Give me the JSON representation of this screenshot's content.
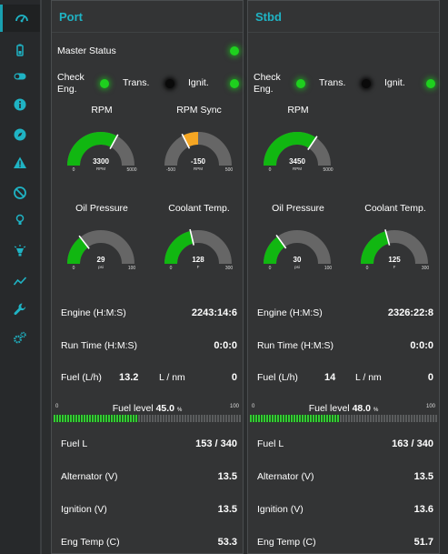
{
  "sidebar": {
    "items": [
      {
        "icon": "gauge-icon",
        "active": true
      },
      {
        "icon": "battery-icon",
        "active": false
      },
      {
        "icon": "toggle-icon",
        "active": false
      },
      {
        "icon": "info-icon",
        "active": false
      },
      {
        "icon": "compass-icon",
        "active": false
      },
      {
        "icon": "warning-icon",
        "active": false
      },
      {
        "icon": "prohibited-icon",
        "active": false
      },
      {
        "icon": "lightbulb-icon",
        "active": false
      },
      {
        "icon": "spotlight-icon",
        "active": false
      },
      {
        "icon": "chart-line-icon",
        "active": false
      },
      {
        "icon": "wrench-icon",
        "active": false
      },
      {
        "icon": "gears-icon",
        "active": false
      }
    ],
    "icon_color": "#1fb3c4"
  },
  "colors": {
    "accent": "#1fb3c4",
    "led_on": "#1ed01e",
    "gauge_green": "#11b711",
    "gauge_orange": "#f5a623",
    "gauge_gray": "#666666"
  },
  "port": {
    "title": "Port",
    "master_status_label": "Master Status",
    "master_status": true,
    "check_eng_label": "Check\nEng.",
    "check_eng": true,
    "trans_label": "Trans.",
    "trans": false,
    "ignit_label": "Ignit.",
    "ignit": true,
    "rpm": {
      "title": "RPM",
      "value": 3300,
      "value_text": "3300",
      "unit": "RPM",
      "min": "0",
      "max": "5000",
      "min_v": 0,
      "max_v": 5000
    },
    "rpm_sync": {
      "title": "RPM Sync",
      "value": -150,
      "value_text": "-150",
      "unit": "RPM",
      "min": "-500",
      "max": "500",
      "min_v": -500,
      "max_v": 500
    },
    "oil": {
      "title": "Oil Pressure",
      "value": 29,
      "value_text": "29",
      "unit": "psi",
      "min": "0",
      "max": "100",
      "min_v": 0,
      "max_v": 100
    },
    "coolant": {
      "title": "Coolant Temp.",
      "value": 128,
      "value_text": "128",
      "unit": "F",
      "min": "0",
      "max": "300",
      "min_v": 0,
      "max_v": 300
    },
    "engine_label": "Engine (H:M:S)",
    "engine_value": "2243:14:6",
    "runtime_label": "Run Time (H:M:S)",
    "runtime_value": "0:0:0",
    "fuel_rate_label": "Fuel (L/h)",
    "fuel_rate_value": "13.2",
    "lnm_label": "L / nm",
    "lnm_value": "0",
    "fuel_level": {
      "label": "Fuel level",
      "value_text": "45.0",
      "unit": "%",
      "min": "0",
      "max": "100",
      "fraction": 0.45
    },
    "fuel_l_label": "Fuel L",
    "fuel_l_value": "153 / 340",
    "alt_label": "Alternator (V)",
    "alt_value": "13.5",
    "ign_label": "Ignition (V)",
    "ign_value": "13.5",
    "engtemp_label": "Eng Temp (C)",
    "engtemp_value": "53.3"
  },
  "stbd": {
    "title": "Stbd",
    "check_eng_label": "Check\nEng.",
    "check_eng": true,
    "trans_label": "Trans.",
    "trans": false,
    "ignit_label": "Ignit.",
    "ignit": true,
    "rpm": {
      "title": "RPM",
      "value": 3450,
      "value_text": "3450",
      "unit": "RPM",
      "min": "0",
      "max": "5000",
      "min_v": 0,
      "max_v": 5000
    },
    "oil": {
      "title": "Oil Pressure",
      "value": 30,
      "value_text": "30",
      "unit": "psi",
      "min": "0",
      "max": "100",
      "min_v": 0,
      "max_v": 100
    },
    "coolant": {
      "title": "Coolant Temp.",
      "value": 125,
      "value_text": "125",
      "unit": "F",
      "min": "0",
      "max": "300",
      "min_v": 0,
      "max_v": 300
    },
    "engine_label": "Engine (H:M:S)",
    "engine_value": "2326:22:8",
    "runtime_label": "Run Time (H:M:S)",
    "runtime_value": "0:0:0",
    "fuel_rate_label": "Fuel (L/h)",
    "fuel_rate_value": "14",
    "lnm_label": "L / nm",
    "lnm_value": "0",
    "fuel_level": {
      "label": "Fuel level",
      "value_text": "48.0",
      "unit": "%",
      "min": "0",
      "max": "100",
      "fraction": 0.48
    },
    "fuel_l_label": "Fuel L",
    "fuel_l_value": "163 / 340",
    "alt_label": "Alternator (V)",
    "alt_value": "13.5",
    "ign_label": "Ignition (V)",
    "ign_value": "13.6",
    "engtemp_label": "Eng Temp (C)",
    "engtemp_value": "51.7"
  }
}
